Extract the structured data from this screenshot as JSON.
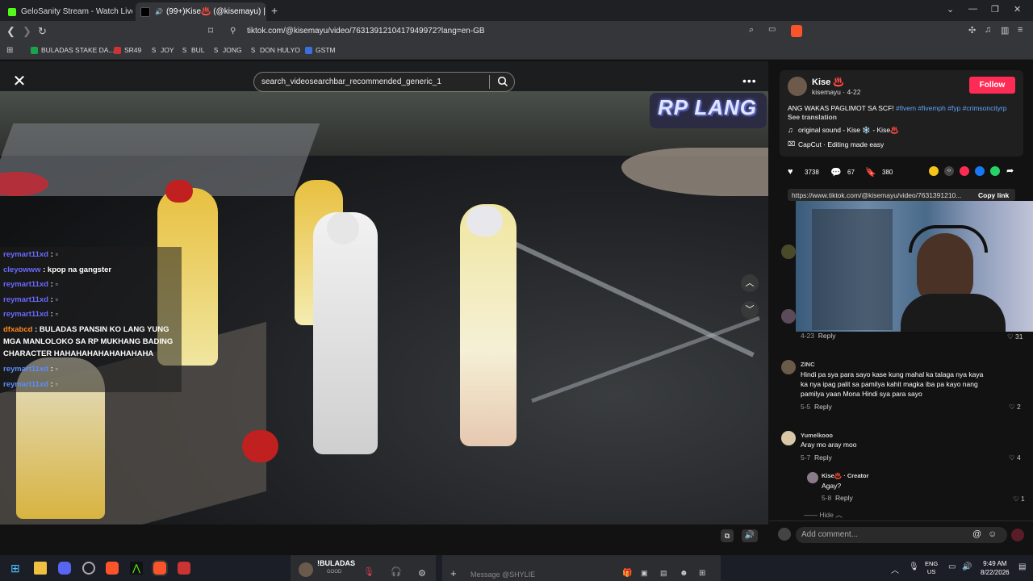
{
  "browser": {
    "tabs": [
      {
        "title": "GeloSanity Stream - Watch Live on K",
        "favicon_color": "#53fc18"
      },
      {
        "title": "(99+)Kise♨️ (@kisemayu) | Ti",
        "favicon_color": "#000000"
      }
    ],
    "url": "tiktok.com/@kisemayu/video/7631391210417949972?lang=en-GB",
    "bookmarks": [
      {
        "label": "BULADAS STAKE DA...",
        "icon": "flag-icon"
      },
      {
        "label": "SR49",
        "icon": "flag-icon"
      },
      {
        "label": "JOY",
        "icon": "s-icon"
      },
      {
        "label": "BUL",
        "icon": "s-icon"
      },
      {
        "label": "JONG",
        "icon": "s-icon"
      },
      {
        "label": "DON HULYO",
        "icon": "s-icon"
      },
      {
        "label": "GSTM",
        "icon": "shield-icon"
      }
    ]
  },
  "player": {
    "search_text": "search_videosearchbar_recommended_generic_1",
    "watermark": "RP LANG",
    "chat": [
      {
        "user": "reymart11xd",
        "msg": ""
      },
      {
        "user": "cleyowww",
        "msg": "kpop na gangster"
      },
      {
        "user": "reymart11xd",
        "msg": ""
      },
      {
        "user": "reymart11xd",
        "msg": ""
      },
      {
        "user": "reymart11xd",
        "msg": ""
      },
      {
        "user": "dfxabcd",
        "msg": "BULADAS PANSIN KO LANG YUNG"
      },
      {
        "user": "",
        "msg": "MGA MANLOLOKO SA RP MUKHANG BADING"
      },
      {
        "user": "",
        "msg": "CHARACTER HAHAHAHAHAHAHAHAHA"
      },
      {
        "user": "reymart11xd",
        "msg": ""
      },
      {
        "user": "reymart11xd",
        "msg": ""
      }
    ]
  },
  "author": {
    "name": "Kise ♨️",
    "handle_date": "kisemayu · 4-22",
    "follow_label": "Follow",
    "caption_text": "ANG WAKAS PAGLIMOT SA SCF! ",
    "caption_tags": "#fivem #fivemph #fyp #crimsoncityrp",
    "see_translation": "See translation",
    "sound": "original sound - Kise ❄️ - Kise♨️",
    "capcut": "CapCut · Editing made easy"
  },
  "stats": {
    "likes": "3738",
    "comments": "67",
    "saves": "380"
  },
  "link": {
    "url": "https://www.tiktok.com/@kisemayu/video/7631391210...",
    "copy_label": "Copy link"
  },
  "comments": [
    {
      "name": "",
      "text": "",
      "date": "4-23",
      "reply": "Reply",
      "likes": "31"
    },
    {
      "name": "ZINC",
      "text1": "Hindi pa sya para sayo kase kung mahal ka talaga nya kaya",
      "text2": "ka nya ipag palit sa pamilya kahit magka iba pa kayo nang",
      "text3": "pamilya yaan Mona Hindi sya para sayo",
      "date": "5-5",
      "reply": "Reply",
      "likes": "2"
    },
    {
      "name": "Yumelkooo",
      "text": "Aray mo aray moo",
      "date": "5-7",
      "reply": "Reply",
      "likes": "4"
    },
    {
      "name": "Kise♨️ · Creator",
      "text": "Agay?",
      "date": "5-8",
      "reply": "Reply",
      "likes": "1"
    }
  ],
  "hide_label": "Hide",
  "add_comment_placeholder": "Add comment...",
  "taskbar": {
    "discord_channel": "!BULADAS",
    "discord_status": "GOOD",
    "message_placeholder": "Message @SHYLIE",
    "lang": "ENG",
    "region": "US",
    "time": "9:49 AM",
    "date": "8/22/2026"
  },
  "colors": {
    "follow": "#fe2c55",
    "hashtag": "#60a5fa",
    "taskbar": "#1b1e26"
  }
}
